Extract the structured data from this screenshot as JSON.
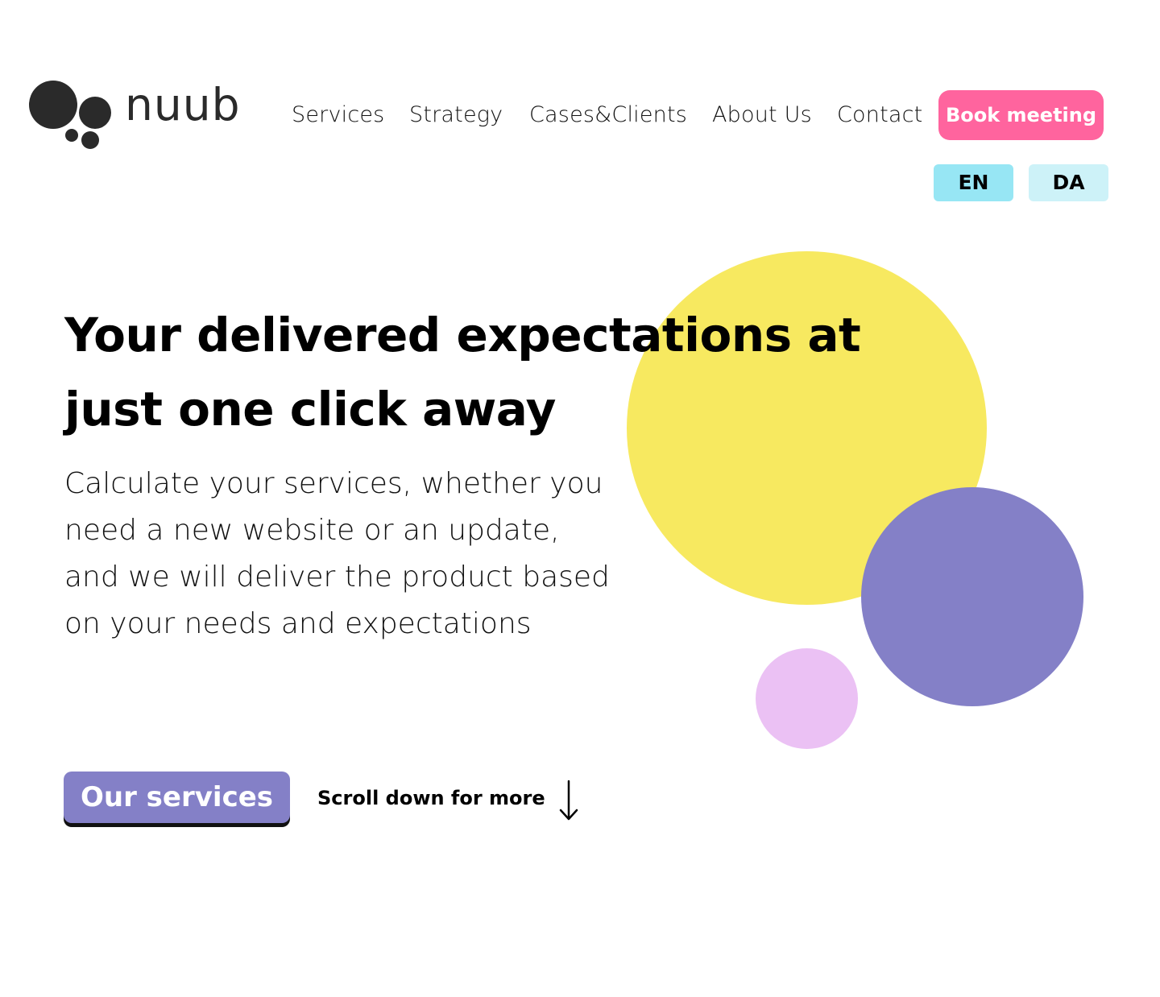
{
  "brand": {
    "name": "nuub"
  },
  "nav": {
    "items": [
      {
        "label": "Services"
      },
      {
        "label": "Strategy"
      },
      {
        "label": "Cases&Clients"
      },
      {
        "label": "About Us"
      },
      {
        "label": "Contact"
      }
    ],
    "cta_label": "Book meeting"
  },
  "languages": {
    "options": [
      "EN",
      "DA"
    ],
    "selected": "EN"
  },
  "hero": {
    "title": "Your delivered expectations at just one click away",
    "description": "Calculate your services, whether you need a new website or an update, and we will deliver the product based on your needs and expectations",
    "primary_button": "Our services",
    "scroll_hint": "Scroll down for more",
    "scroll_icon": "arrow-down-icon"
  },
  "colors": {
    "accent_pink": "#ff649e",
    "accent_purple": "#8480c7",
    "lang_active": "#97e6f4",
    "lang_inactive": "#cdf2f8",
    "circle_yellow": "#f7e960",
    "circle_purple": "#8480c7",
    "circle_pink": "#ebc1f4",
    "logo_dark": "#2a2a2a"
  }
}
